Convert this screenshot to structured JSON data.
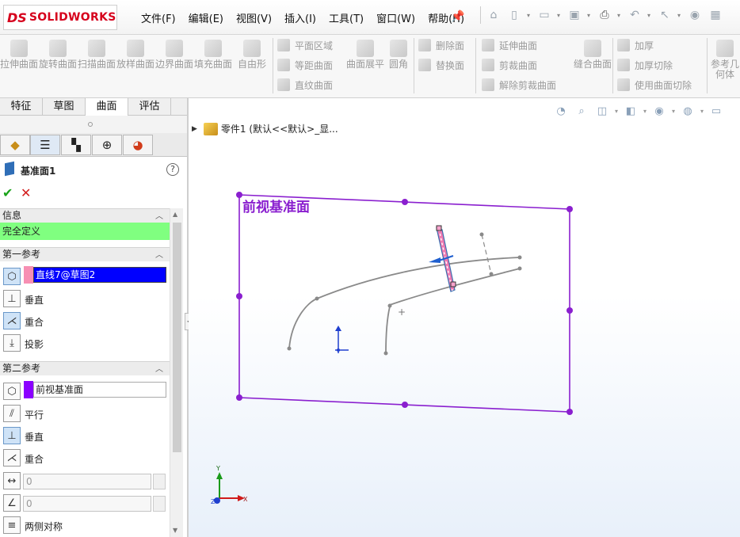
{
  "logo": {
    "mark": "DS",
    "brand": "SOLIDWORKS"
  },
  "menu": [
    "文件(F)",
    "编辑(E)",
    "视图(V)",
    "插入(I)",
    "工具(T)",
    "窗口(W)",
    "帮助(H)"
  ],
  "quick_access": [
    "home-icon",
    "new-icon",
    "open-icon",
    "save-icon",
    "print-icon",
    "undo-icon",
    "select-icon",
    "rebuild-icon",
    "options-icon"
  ],
  "ribbon": {
    "big_buttons": [
      {
        "id": "extrude",
        "label": "拉伸曲面"
      },
      {
        "id": "revolve",
        "label": "旋转曲面"
      },
      {
        "id": "sweep",
        "label": "扫描曲面"
      },
      {
        "id": "loft",
        "label": "放样曲面"
      },
      {
        "id": "boundary",
        "label": "边界曲面"
      },
      {
        "id": "fill",
        "label": "填充曲面"
      },
      {
        "id": "freeform",
        "label": "自由形"
      }
    ],
    "col1": [
      "平面区域",
      "等距曲面",
      "直纹曲面"
    ],
    "flatten": "曲面展平",
    "fillet": "圆角",
    "col2": [
      "删除面",
      "替换面"
    ],
    "col3": [
      "延伸曲面",
      "剪裁曲面",
      "解除剪裁曲面"
    ],
    "knit": "缝合曲面",
    "col4": [
      "加厚",
      "加厚切除",
      "使用曲面切除"
    ],
    "ref_geom": "参考几何体"
  },
  "tabs": [
    "特征",
    "草图",
    "曲面",
    "评估"
  ],
  "active_tab": "曲面",
  "property_manager": {
    "title": "基准面1",
    "help": "?",
    "ok": "✔",
    "cancel": "✕",
    "info_header": "信息",
    "status": "完全定义",
    "first_ref": {
      "header": "第一参考",
      "value": "直线7@草图2",
      "chip_color": "#f78fb3",
      "options": [
        "垂直",
        "重合",
        "投影"
      ]
    },
    "second_ref": {
      "header": "第二参考",
      "value": "前视基准面",
      "chip_color": "#8a00ff",
      "options": [
        "平行",
        "垂直",
        "重合"
      ],
      "offset_value": "0",
      "angle_value": "0",
      "symmetric": "两侧对称"
    }
  },
  "viewport": {
    "tree_item": "零件1  (默认<<默认>_显...",
    "plane_label": "前视基准面",
    "plane_color": "#8a1fcf",
    "triad": {
      "x": "X",
      "y": "Y",
      "z": "Z"
    }
  }
}
